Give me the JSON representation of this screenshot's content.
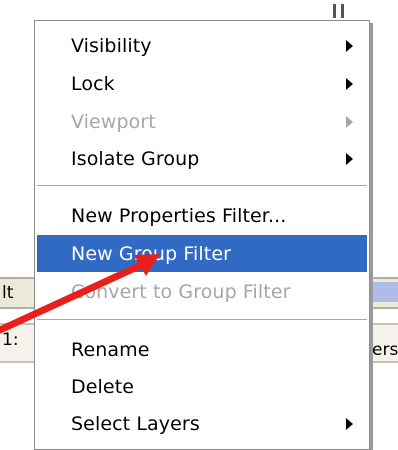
{
  "background": {
    "left_fragments": [
      "lt",
      "1:"
    ],
    "right_fragment": "ers"
  },
  "menu": {
    "items": [
      {
        "label": "Visibility",
        "submenu": true,
        "enabled": true
      },
      {
        "label": "Lock",
        "submenu": true,
        "enabled": true
      },
      {
        "label": "Viewport",
        "submenu": true,
        "enabled": false
      },
      {
        "label": "Isolate Group",
        "submenu": true,
        "enabled": true
      },
      {
        "label": "New Properties Filter...",
        "submenu": false,
        "enabled": true
      },
      {
        "label": "New Group Filter",
        "submenu": false,
        "enabled": true,
        "highlighted": true
      },
      {
        "label": "Convert to Group Filter",
        "submenu": false,
        "enabled": false
      },
      {
        "label": "Rename",
        "submenu": false,
        "enabled": true
      },
      {
        "label": "Delete",
        "submenu": false,
        "enabled": true
      },
      {
        "label": "Select Layers",
        "submenu": true,
        "enabled": true
      }
    ]
  },
  "annotation": {
    "arrow_color": "#e8201c"
  },
  "colors": {
    "highlight": "#316ac5",
    "disabled_text": "#a6a6a6"
  }
}
